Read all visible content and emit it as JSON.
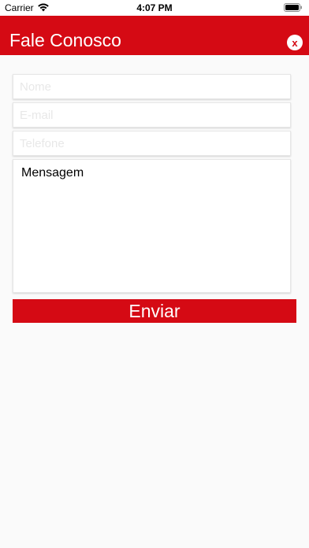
{
  "status_bar": {
    "carrier": "Carrier",
    "time": "4:07 PM"
  },
  "header": {
    "title": "Fale Conosco",
    "close_label": "x"
  },
  "form": {
    "name_placeholder": "Nome",
    "email_placeholder": "E-mail",
    "phone_placeholder": "Telefone",
    "message_value": "Mensagem",
    "send_label": "Enviar"
  },
  "colors": {
    "accent": "#d50a14",
    "background": "#fafafa"
  }
}
